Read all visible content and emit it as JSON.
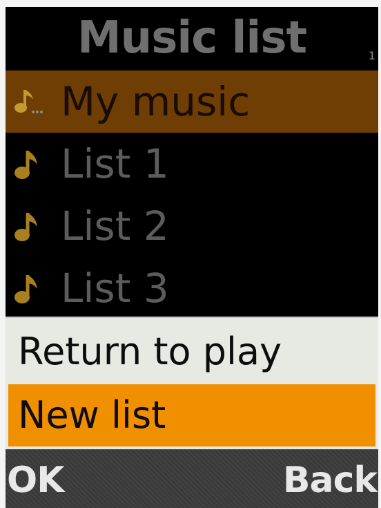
{
  "title": "Music list",
  "page_indicator": "1",
  "list": {
    "items": [
      {
        "label": "My music",
        "icon": "music-folder-icon",
        "selected": true
      },
      {
        "label": "List 1",
        "icon": "music-note-icon",
        "selected": false
      },
      {
        "label": "List 2",
        "icon": "music-note-icon",
        "selected": false
      },
      {
        "label": "List 3",
        "icon": "music-note-icon",
        "selected": false
      }
    ]
  },
  "options_menu": {
    "items": [
      {
        "label": "Return to play",
        "highlighted": false
      },
      {
        "label": "New list",
        "highlighted": true
      }
    ]
  },
  "softkeys": {
    "left": "OK",
    "right": "Back"
  },
  "colors": {
    "background": "#000000",
    "selected_row": "#6e3e04",
    "menu_background": "#e6eae3",
    "menu_highlight": "#f08f00",
    "softkey_bar": "#3a3a3a",
    "note_icon": "#b8860b"
  }
}
